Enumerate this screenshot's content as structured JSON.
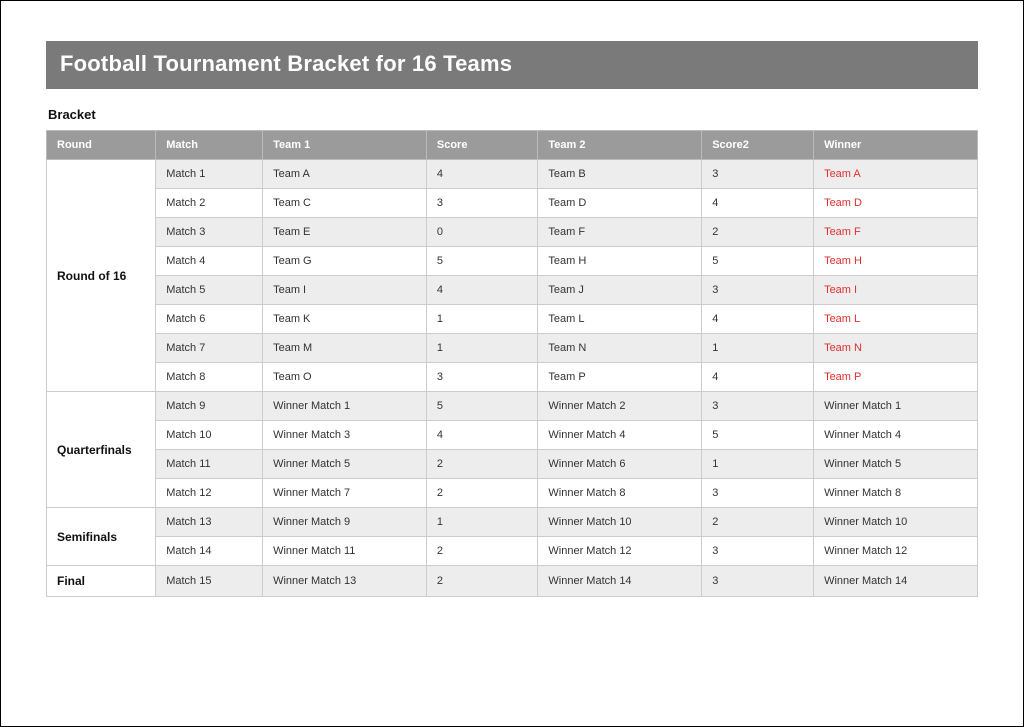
{
  "title": "Football Tournament Bracket for 16 Teams",
  "section_label": "Bracket",
  "columns": {
    "round": "Round",
    "match": "Match",
    "team1": "Team 1",
    "score": "Score",
    "team2": "Team 2",
    "score2": "Score2",
    "winner": "Winner"
  },
  "rounds": [
    {
      "name": "Round of 16",
      "matches": [
        {
          "match": "Match 1",
          "team1": "Team A",
          "score1": "4",
          "team2": "Team B",
          "score2": "3",
          "winner": "Team A",
          "winner_is_team": true
        },
        {
          "match": "Match 2",
          "team1": "Team C",
          "score1": "3",
          "team2": "Team D",
          "score2": "4",
          "winner": "Team D",
          "winner_is_team": true
        },
        {
          "match": "Match 3",
          "team1": "Team E",
          "score1": "0",
          "team2": "Team F",
          "score2": "2",
          "winner": "Team F",
          "winner_is_team": true
        },
        {
          "match": "Match 4",
          "team1": "Team G",
          "score1": "5",
          "team2": "Team H",
          "score2": "5",
          "winner": "Team H",
          "winner_is_team": true
        },
        {
          "match": "Match 5",
          "team1": "Team I",
          "score1": "4",
          "team2": "Team J",
          "score2": "3",
          "winner": "Team I",
          "winner_is_team": true
        },
        {
          "match": "Match 6",
          "team1": "Team K",
          "score1": "1",
          "team2": "Team L",
          "score2": "4",
          "winner": "Team L",
          "winner_is_team": true
        },
        {
          "match": "Match 7",
          "team1": "Team M",
          "score1": "1",
          "team2": "Team N",
          "score2": "1",
          "winner": "Team N",
          "winner_is_team": true
        },
        {
          "match": "Match 8",
          "team1": "Team O",
          "score1": "3",
          "team2": "Team P",
          "score2": "4",
          "winner": "Team P",
          "winner_is_team": true
        }
      ]
    },
    {
      "name": "Quarterfinals",
      "matches": [
        {
          "match": "Match 9",
          "team1": "Winner Match 1",
          "score1": "5",
          "team2": "Winner Match 2",
          "score2": "3",
          "winner": "Winner Match 1",
          "winner_is_team": false
        },
        {
          "match": "Match 10",
          "team1": "Winner Match 3",
          "score1": "4",
          "team2": "Winner Match 4",
          "score2": "5",
          "winner": "Winner Match 4",
          "winner_is_team": false
        },
        {
          "match": "Match 11",
          "team1": "Winner Match 5",
          "score1": "2",
          "team2": "Winner Match 6",
          "score2": "1",
          "winner": "Winner Match 5",
          "winner_is_team": false
        },
        {
          "match": "Match 12",
          "team1": "Winner Match 7",
          "score1": "2",
          "team2": "Winner Match 8",
          "score2": "3",
          "winner": "Winner Match 8",
          "winner_is_team": false
        }
      ]
    },
    {
      "name": "Semifinals",
      "matches": [
        {
          "match": "Match 13",
          "team1": "Winner Match 9",
          "score1": "1",
          "team2": "Winner Match 10",
          "score2": "2",
          "winner": "Winner Match 10",
          "winner_is_team": false
        },
        {
          "match": "Match 14",
          "team1": "Winner Match 11",
          "score1": "2",
          "team2": "Winner Match 12",
          "score2": "3",
          "winner": "Winner Match 12",
          "winner_is_team": false
        }
      ]
    },
    {
      "name": "Final",
      "matches": [
        {
          "match": "Match 15",
          "team1": "Winner Match 13",
          "score1": "2",
          "team2": "Winner Match 14",
          "score2": "3",
          "winner": "Winner Match 14",
          "winner_is_team": false
        }
      ]
    }
  ]
}
